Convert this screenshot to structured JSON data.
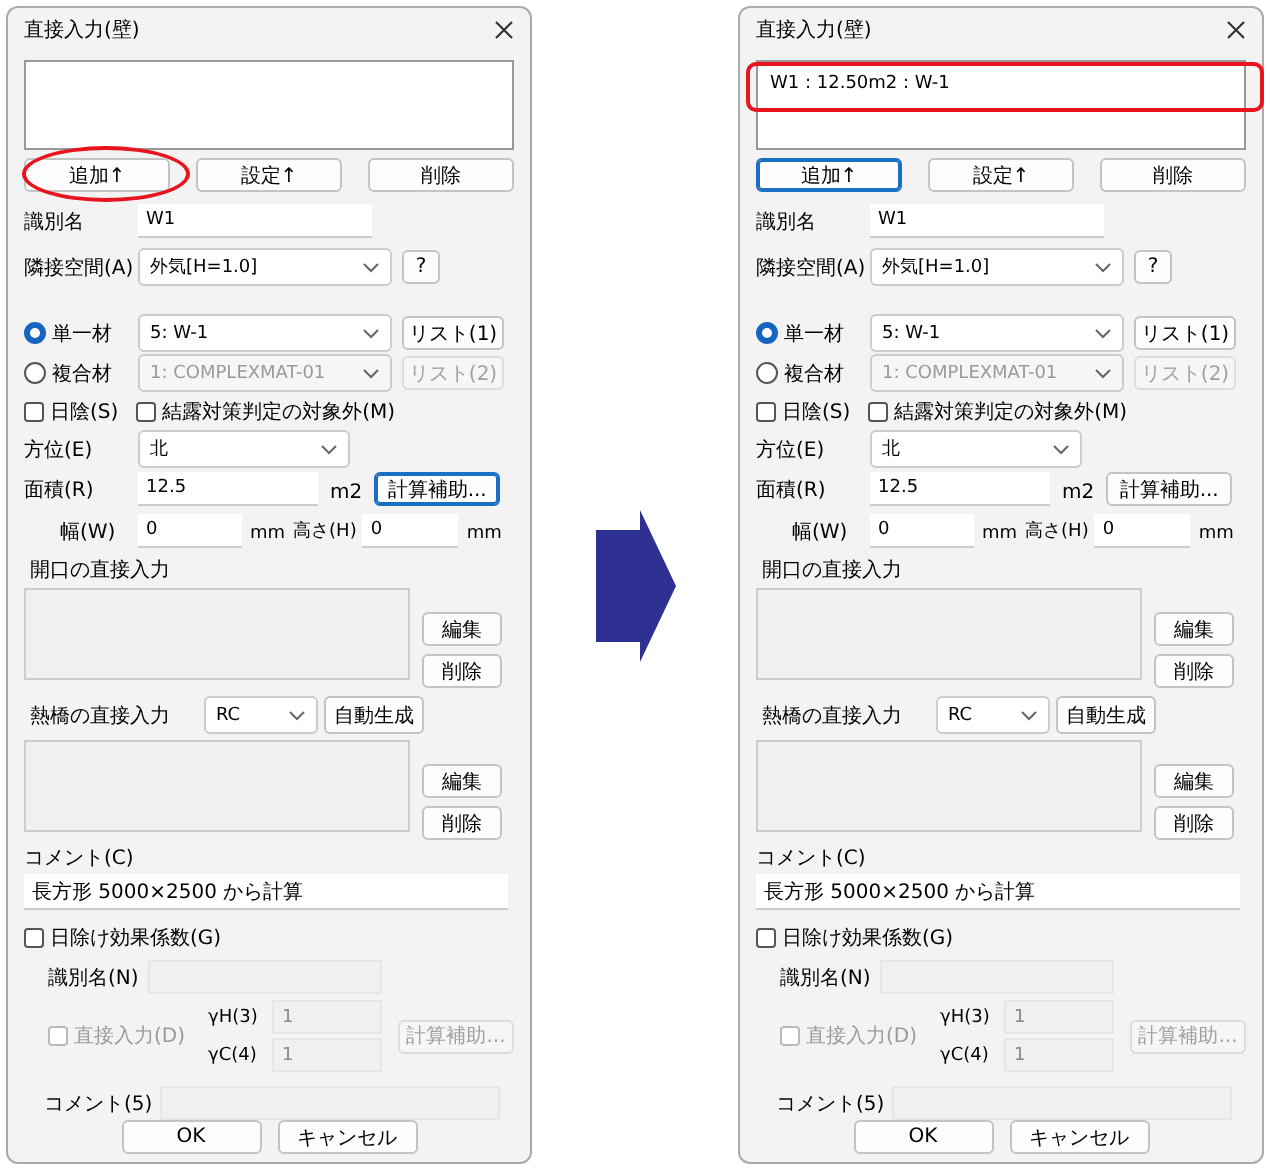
{
  "dialogs": [
    {
      "title": "直接入力(壁)",
      "annotation": {
        "kind": "ellipse"
      },
      "list_buttons": [
        {
          "label": "追加↑",
          "focused": false
        },
        {
          "label": "設定↑",
          "focused": false
        },
        {
          "label": "削除",
          "focused": false
        }
      ],
      "id_field": {
        "label": "識別名",
        "value": "W1"
      },
      "adjacent": {
        "label": "隣接空間(A)",
        "value": "外気[H=1.0]",
        "help_button": "?"
      },
      "materials": [
        {
          "label": "単一材",
          "selected": true,
          "value": "5: W-1",
          "button": "リスト(1)"
        },
        {
          "label": "複合材",
          "selected": false,
          "value": "1: COMPLEXMAT-01",
          "button": "リスト(2)"
        }
      ],
      "checkboxes": [
        {
          "label": "日陰(S)",
          "checked": false
        },
        {
          "label": "結露対策判定の対象外(M)",
          "checked": false
        }
      ],
      "orientation": {
        "label": "方位(E)",
        "value": "北"
      },
      "area": {
        "label": "面積(R)",
        "value": "12.5",
        "unit": "m2",
        "button": {
          "label": "計算補助...",
          "focused": true
        }
      },
      "width": {
        "label": "幅(W)",
        "value": "0",
        "unit": "mm"
      },
      "height": {
        "label": "高さ(H)",
        "value": "0",
        "unit": "mm"
      },
      "openings": {
        "label": "開口の直接入力",
        "buttons": [
          "編集",
          "削除"
        ]
      },
      "thermal_bridges": {
        "label": "熱橋の直接入力",
        "select": "RC",
        "auto_button": "自動生成",
        "buttons": [
          "編集",
          "削除"
        ]
      },
      "comment": {
        "label": "コメント(C)",
        "value": "長方形 5000×2500 から計算"
      },
      "shading": {
        "label": "日除け効果係数(G)",
        "checked": false,
        "id_label": "識別名(N)",
        "direct": {
          "label": "直接入力(D)",
          "checked": false
        },
        "gamma_h": {
          "label": "γH(3)",
          "value": "1"
        },
        "gamma_c": {
          "label": "γC(4)",
          "value": "1"
        },
        "calc_button": "計算補助...",
        "comment_label": "コメント(5)"
      },
      "footer_buttons": [
        "OK",
        "キャンセル"
      ]
    },
    {
      "title": "直接入力(壁)",
      "annotation": {
        "kind": "frame"
      },
      "list_items": [
        "W1 : 12.50m2 : W-1"
      ],
      "list_buttons": [
        {
          "label": "追加↑",
          "focused": true
        },
        {
          "label": "設定↑",
          "focused": false
        },
        {
          "label": "削除",
          "focused": false
        }
      ],
      "id_field": {
        "label": "識別名",
        "value": "W1"
      },
      "adjacent": {
        "label": "隣接空間(A)",
        "value": "外気[H=1.0]",
        "help_button": "?"
      },
      "materials": [
        {
          "label": "単一材",
          "selected": true,
          "value": "5: W-1",
          "button": "リスト(1)"
        },
        {
          "label": "複合材",
          "selected": false,
          "value": "1: COMPLEXMAT-01",
          "button": "リスト(2)"
        }
      ],
      "checkboxes": [
        {
          "label": "日陰(S)",
          "checked": false
        },
        {
          "label": "結露対策判定の対象外(M)",
          "checked": false
        }
      ],
      "orientation": {
        "label": "方位(E)",
        "value": "北"
      },
      "area": {
        "label": "面積(R)",
        "value": "12.5",
        "unit": "m2",
        "button": {
          "label": "計算補助...",
          "focused": false
        }
      },
      "width": {
        "label": "幅(W)",
        "value": "0",
        "unit": "mm"
      },
      "height": {
        "label": "高さ(H)",
        "value": "0",
        "unit": "mm"
      },
      "openings": {
        "label": "開口の直接入力",
        "buttons": [
          "編集",
          "削除"
        ]
      },
      "thermal_bridges": {
        "label": "熱橋の直接入力",
        "select": "RC",
        "auto_button": "自動生成",
        "buttons": [
          "編集",
          "削除"
        ]
      },
      "comment": {
        "label": "コメント(C)",
        "value": "長方形 5000×2500 から計算"
      },
      "shading": {
        "label": "日除け効果係数(G)",
        "checked": false,
        "id_label": "識別名(N)",
        "direct": {
          "label": "直接入力(D)",
          "checked": false
        },
        "gamma_h": {
          "label": "γH(3)",
          "value": "1"
        },
        "gamma_c": {
          "label": "γC(4)",
          "value": "1"
        },
        "calc_button": "計算補助...",
        "comment_label": "コメント(5)"
      },
      "footer_buttons": [
        "OK",
        "キャンセル"
      ]
    }
  ]
}
